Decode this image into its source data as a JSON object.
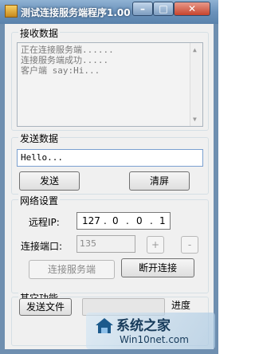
{
  "window": {
    "title": "测试连接服务端程序1.00",
    "controls": {
      "minimize": "–",
      "maximize": "□",
      "close": "✕"
    }
  },
  "receive": {
    "group_label": "接收数据",
    "lines": [
      "正在连接服务端......",
      "连接服务端成功.....",
      "客户端 say:Hi..."
    ]
  },
  "send": {
    "group_label": "发送数据",
    "input_value": "Hello...",
    "send_label": "发送",
    "clear_label": "清屏"
  },
  "network": {
    "group_label": "网络设置",
    "ip_label": "远程IP:",
    "ip_parts": [
      "127",
      "0",
      "0",
      "1"
    ],
    "port_label": "连接端口:",
    "port_value": "135",
    "plus_label": "+",
    "minus_label": "-",
    "connect_label": "连接服务端",
    "disconnect_label": "断开连接"
  },
  "other": {
    "group_label": "其它功能",
    "send_file_label": "发送文件",
    "progress_label": "进度",
    "progress_fraction": 0
  },
  "watermark": {
    "name": "系统之家",
    "url": "Win10net.com"
  },
  "colors": {
    "titlebar": "#6b92bb",
    "client_bg": "#f0f0f0",
    "progress_fill": "#3aa34b"
  }
}
